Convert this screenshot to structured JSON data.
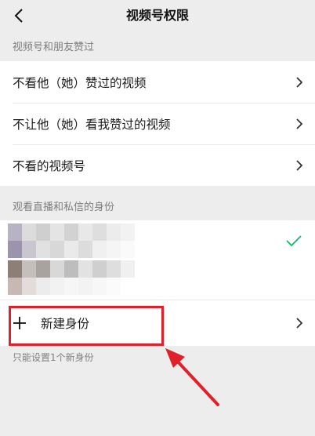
{
  "nav": {
    "title": "视频号权限",
    "back_icon": "chevron-left-icon"
  },
  "section1": {
    "header": "视频号和朋友赞过",
    "items": [
      {
        "label": "不看他（她）赞过的视频"
      },
      {
        "label": "不让他（她）看我赞过的视频"
      },
      {
        "label": "不看的视频号"
      }
    ]
  },
  "section2": {
    "header": "观看直播和私信的身份",
    "identities": [
      {
        "name": "",
        "selected": true
      },
      {
        "name": "",
        "selected": false
      }
    ],
    "new_identity_label": "新建身份",
    "new_identity_icon": "plus-icon",
    "footnote": "只能设置1个新身份"
  },
  "colors": {
    "accent_green": "#07c160",
    "highlight_red": "#e0202a",
    "background": "#ededed"
  }
}
